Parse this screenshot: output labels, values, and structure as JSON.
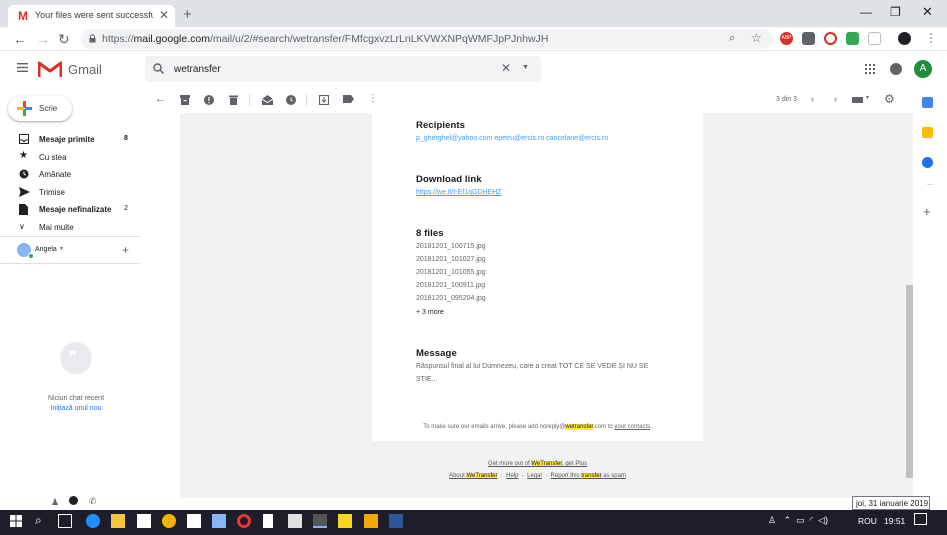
{
  "browser": {
    "tab_title": "Your files were sent successfully",
    "url_prefix": "https://",
    "url_host": "mail.google.com",
    "url_rest": "/mail/u/2/#search/wetransfer/FMfcgxvzLrLnLKVWXNPqWMFJpPJnhwJH",
    "ext_badge": "ABP"
  },
  "gmail": {
    "logo_text": "Gmail",
    "search_value": "wetransfer",
    "avatar_letter": "A",
    "compose_label": "Scrie",
    "sidebar": [
      {
        "label": "Mesaje primite",
        "count": "8",
        "bold": true,
        "icon": "inbox-icon"
      },
      {
        "label": "Cu stea",
        "count": "",
        "bold": false,
        "icon": "star-icon"
      },
      {
        "label": "Amânate",
        "count": "",
        "bold": false,
        "icon": "clock-icon"
      },
      {
        "label": "Trimise",
        "count": "",
        "bold": false,
        "icon": "send-icon"
      },
      {
        "label": "Mesaje nefinalizate",
        "count": "2",
        "bold": true,
        "icon": "draft-icon"
      },
      {
        "label": "Mai multe",
        "count": "",
        "bold": false,
        "icon": "chevron-down-icon"
      }
    ],
    "hangouts_user": "Angela",
    "no_chat": "Niciun chat recent",
    "start_chat": "Inițiază unul nou",
    "pager": "3 din 3"
  },
  "email": {
    "recipients_heading": "Recipients",
    "recipients": "p_gherghel@yahoo.com epetru@ercis.ro cancelarie@ercis.ro",
    "download_heading": "Download link",
    "download_link": "https://we.tl/t-Ef1qGDHEHZ",
    "files_heading": "8 files",
    "files": [
      "20181201_100715.jpg",
      "20181201_101027.jpg",
      "20181201_101055.jpg",
      "20181201_100911.jpg",
      "20181201_095204.jpg"
    ],
    "more": "+ 3 more",
    "message_heading": "Message",
    "message_line1": "Răspunsul final al lui Dumnezeu, care a creat TOT CE SE VEDE ȘI NU SE",
    "message_line2": "ȘTIE...",
    "footer_pre": "To make sure our emails arrive, please add noreply@",
    "footer_hl": "wetransfer",
    "footer_mid": ".com to ",
    "footer_link": "your contacts",
    "footer_end": ".",
    "promo_pre": "Get more out of ",
    "promo_hl": "WeTransfer",
    "promo_post": ", get Plus",
    "about_pre": "About ",
    "about_hl": "WeTransfer",
    "help": "Help",
    "legal": "Legal",
    "report_pre": "Report this ",
    "report_hl": "transfer",
    "report_post": " as spam",
    "dot": "·"
  },
  "taskbar": {
    "lang": "ROU",
    "time": "19:51",
    "date_tooltip": "joi, 31 ianuarie 2019"
  },
  "colors": {
    "gmail_red": "#d93025",
    "link_blue": "#409fff",
    "highlight": "#ffeb3b",
    "avatar_green": "#1e8e3e"
  }
}
